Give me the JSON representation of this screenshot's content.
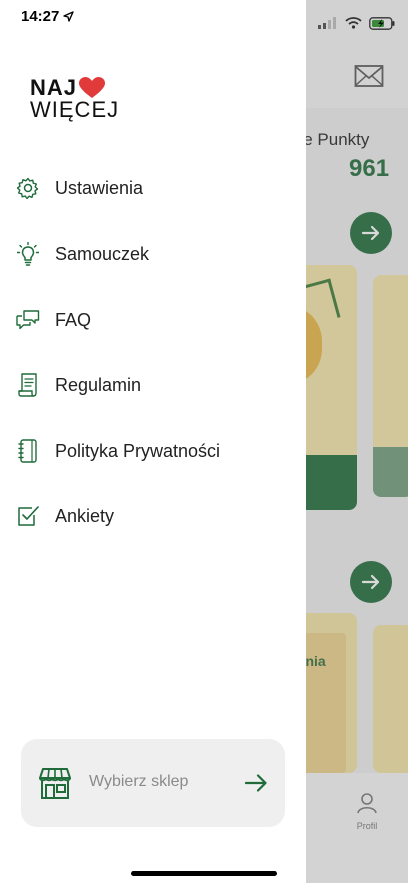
{
  "status_bar": {
    "time": "14:27"
  },
  "logo": {
    "line1": "NAJ",
    "line2": "WIĘCEJ",
    "heart_color": "#e03a3a"
  },
  "drawer_menu": {
    "items": [
      {
        "label": "Ustawienia",
        "icon": "gear-icon"
      },
      {
        "label": "Samouczek",
        "icon": "lightbulb-icon"
      },
      {
        "label": "FAQ",
        "icon": "chat-bubbles-icon"
      },
      {
        "label": "Regulamin",
        "icon": "document-icon"
      },
      {
        "label": "Polityka Prywatności",
        "icon": "notebook-icon"
      },
      {
        "label": "Ankiety",
        "icon": "checkbox-icon"
      }
    ]
  },
  "shop_selector": {
    "label": "Wybierz sklep",
    "icon": "store-icon",
    "arrow_icon": "arrow-right-icon"
  },
  "background": {
    "points_label": "oje Punkty",
    "points_value": "961",
    "card_text": "rnia",
    "tab_profile_label": "Profil"
  },
  "colors": {
    "accent": "#1f6b3a",
    "text": "#222222",
    "card_bg": "#efefef"
  }
}
